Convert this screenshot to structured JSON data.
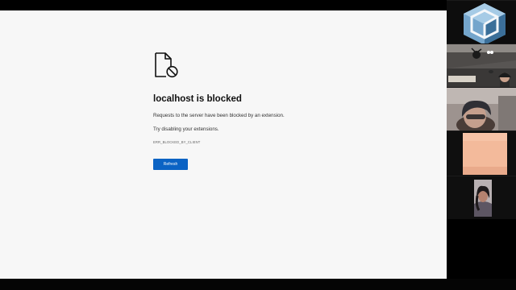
{
  "error_page": {
    "icon": "blocked-document-icon",
    "title": "localhost is blocked",
    "message": "Requests to the server have been blocked by an extension.",
    "suggestion": "Try disabling your extensions.",
    "error_code": "ERR_BLOCKED_BY_CLIENT",
    "refresh_label": "Refresh"
  },
  "colors": {
    "page_background": "#f7f7f7",
    "button_blue": "#0b63c4",
    "title_text": "#111111",
    "side_panel": "#121212"
  },
  "participants": [
    {
      "type": "logo",
      "icon": "cube-logo-icon"
    },
    {
      "type": "video"
    },
    {
      "type": "video"
    },
    {
      "type": "video"
    },
    {
      "type": "video"
    }
  ]
}
